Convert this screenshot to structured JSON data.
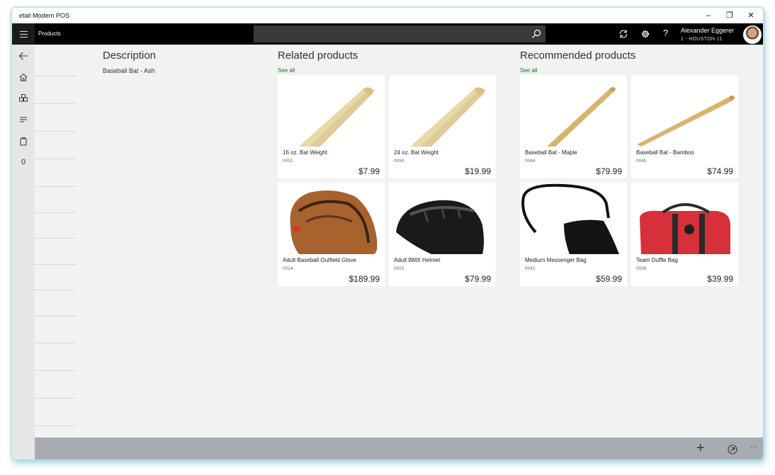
{
  "window": {
    "title": "etail Modern POS",
    "controls": {
      "minimize": "–",
      "maximize": "❐",
      "close": "✕"
    }
  },
  "appbar": {
    "page_label": "Products",
    "search_placeholder": "",
    "icons": [
      "refresh-icon",
      "settings-icon",
      "help-icon"
    ],
    "help_glyph": "?",
    "user": {
      "name": "Alexander Eggerer",
      "store": "1 - HOUSTON-11"
    }
  },
  "left_rail": {
    "icons": [
      "back-arrow-icon",
      "home-icon",
      "products-icon",
      "transactions-icon",
      "bag-icon",
      "zero-count-icon"
    ],
    "count": "0"
  },
  "description": {
    "heading": "Description",
    "text": "Baseball Bat - Ash"
  },
  "related": {
    "heading": "Related products",
    "see_all": "See all",
    "items": [
      {
        "name": "16 oz. Bat Weight",
        "number": "0051",
        "price": "$7.99",
        "image": "bat"
      },
      {
        "name": "24 oz. Bat Weight",
        "number": "0050",
        "price": "$19.99",
        "image": "bat"
      },
      {
        "name": "Adult Baseball Outfield Glove",
        "number": "0014",
        "price": "$189.99",
        "image": "glove"
      },
      {
        "name": "Adult BMX Helmet",
        "number": "0023",
        "price": "$79.99",
        "image": "helmet"
      }
    ]
  },
  "recommended": {
    "heading": "Recommended products",
    "see_all": "See all",
    "items": [
      {
        "name": "Baseball Bat - Maple",
        "number": "0044",
        "price": "$79.99",
        "image": "bat-thin"
      },
      {
        "name": "Baseball Bat - Bamboo",
        "number": "0045",
        "price": "$74.99",
        "image": "bat-long"
      },
      {
        "name": "Medium Messenger Bag",
        "number": "0042",
        "price": "$59.99",
        "image": "messenger-bag"
      },
      {
        "name": "Team Duffle Bag",
        "number": "0039",
        "price": "$39.99",
        "image": "duffle-bag"
      }
    ]
  },
  "bottom_bar": {
    "icons": [
      "add-icon",
      "circle-arrow-icon",
      "more-icon"
    ],
    "add_glyph": "+",
    "more_glyph": "···"
  }
}
